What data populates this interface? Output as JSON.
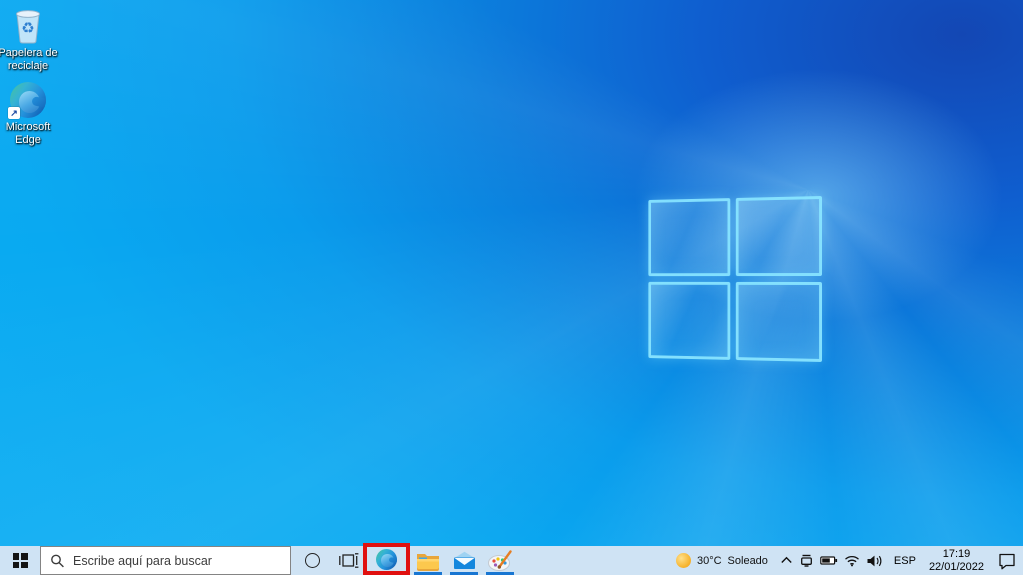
{
  "desktop": {
    "icons": [
      {
        "name": "recycle-bin",
        "label": "Papelera de reciclaje"
      },
      {
        "name": "microsoft-edge",
        "label": "Microsoft Edge"
      }
    ]
  },
  "taskbar": {
    "background_color": "#cfe3f4",
    "start": {
      "icon": "windows-start-icon"
    },
    "search": {
      "icon": "search-icon",
      "placeholder": "Escribe aquí para buscar",
      "value": ""
    },
    "buttons": [
      {
        "icon": "cortana-icon"
      },
      {
        "icon": "task-view-icon"
      },
      {
        "icon": "edge-icon",
        "highlighted": true,
        "running": false
      },
      {
        "icon": "file-explorer-icon",
        "running": true
      },
      {
        "icon": "mail-icon",
        "running": true
      },
      {
        "icon": "paint3d-icon",
        "running": true
      }
    ],
    "annotation": {
      "shape": "rectangle",
      "color": "#e01010",
      "target": "edge-taskbar-button"
    },
    "tray": {
      "weather_icon": "sun-icon",
      "temperature": "30°C",
      "condition": "Soleado",
      "hidden_icons_chevron": "chevron-up-icon",
      "icons": [
        "device-icon",
        "battery-icon",
        "wifi-icon",
        "volume-icon"
      ],
      "language": "ESP",
      "time": "17:19",
      "date": "22/01/2022",
      "action_center": "action-center-icon"
    }
  },
  "wallpaper": {
    "style": "windows-10-light-rays",
    "base_colors": [
      "#0aacf2",
      "#1347b4"
    ],
    "logo_border_color": "#87e4ff"
  }
}
